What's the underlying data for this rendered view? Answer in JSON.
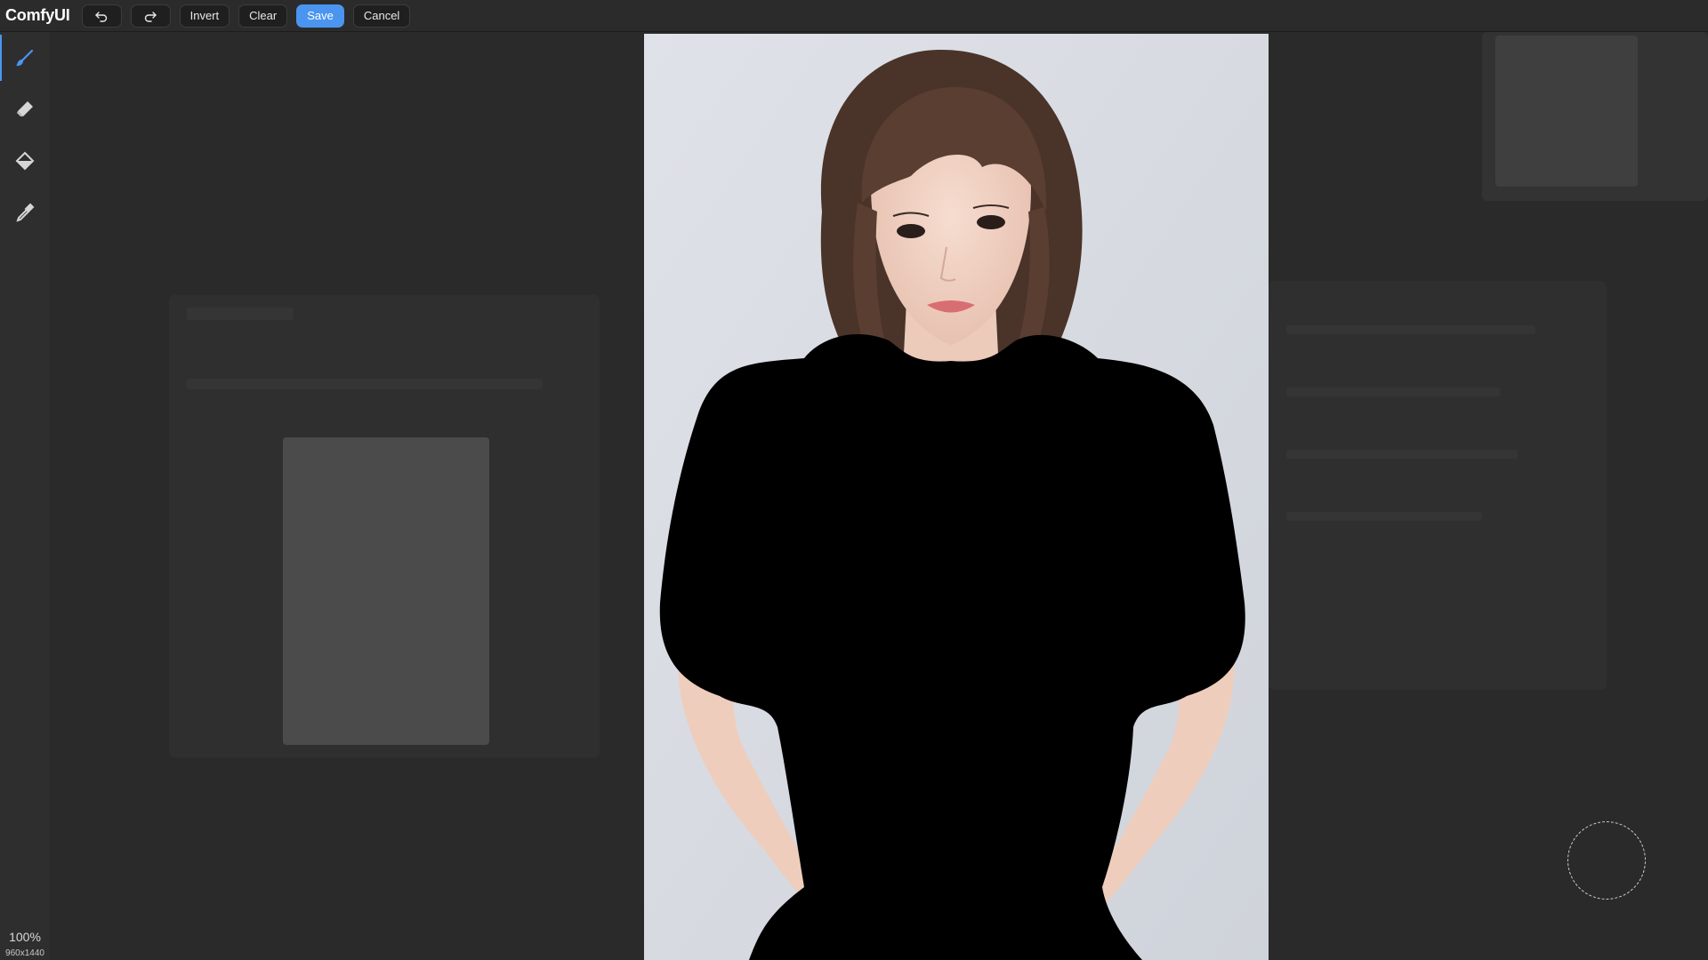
{
  "app": {
    "title": "ComfyUI"
  },
  "toolbar": {
    "undo_icon": "undo-icon",
    "redo_icon": "redo-icon",
    "invert_label": "Invert",
    "clear_label": "Clear",
    "save_label": "Save",
    "cancel_label": "Cancel"
  },
  "tools": [
    {
      "name": "brush",
      "icon": "brush-icon",
      "active": true
    },
    {
      "name": "eraser",
      "icon": "eraser-icon",
      "active": false
    },
    {
      "name": "paint-bucket",
      "icon": "paint-bucket-icon",
      "active": false
    },
    {
      "name": "color-picker",
      "icon": "eyedropper-icon",
      "active": false
    }
  ],
  "status": {
    "zoom": "100%",
    "image_size": "960x1440"
  },
  "colors": {
    "accent": "#4a95f0",
    "mask": "#000000",
    "background": "#d7dbe1"
  }
}
